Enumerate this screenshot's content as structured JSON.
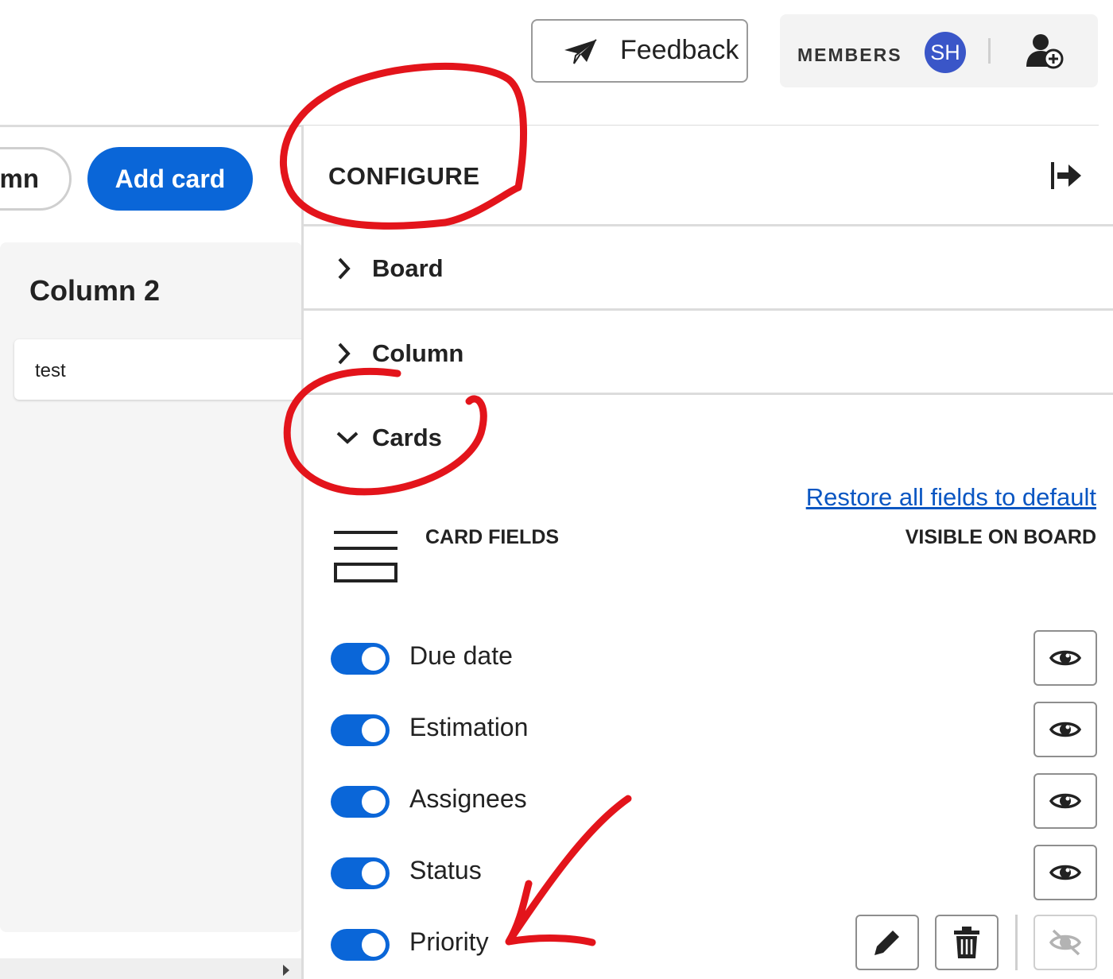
{
  "header": {
    "feedback_label": "Feedback",
    "members_label": "MEMBERS",
    "avatar_initials": "SH",
    "avatar_color": "#3a56c8"
  },
  "board": {
    "add_column_label_partial": "mn",
    "add_card_label": "Add card",
    "column_title": "Column 2",
    "card_text": "test"
  },
  "panel": {
    "title": "CONFIGURE",
    "sections": [
      {
        "label": "Board",
        "expanded": false
      },
      {
        "label": "Column",
        "expanded": false
      },
      {
        "label": "Cards",
        "expanded": true
      }
    ],
    "restore_link": "Restore all fields to default",
    "card_fields_label": "CARD FIELDS",
    "visible_label": "VISIBLE ON BOARD",
    "fields": [
      {
        "label": "Due date",
        "enabled": true,
        "visible": true
      },
      {
        "label": "Estimation",
        "enabled": true,
        "visible": true
      },
      {
        "label": "Assignees",
        "enabled": true,
        "visible": true
      },
      {
        "label": "Status",
        "enabled": true,
        "visible": true
      },
      {
        "label": "Priority",
        "enabled": true,
        "visible": false
      }
    ]
  },
  "colors": {
    "accent": "#0a66d8",
    "annotation": "#e3141b",
    "link": "#0a56c2"
  }
}
